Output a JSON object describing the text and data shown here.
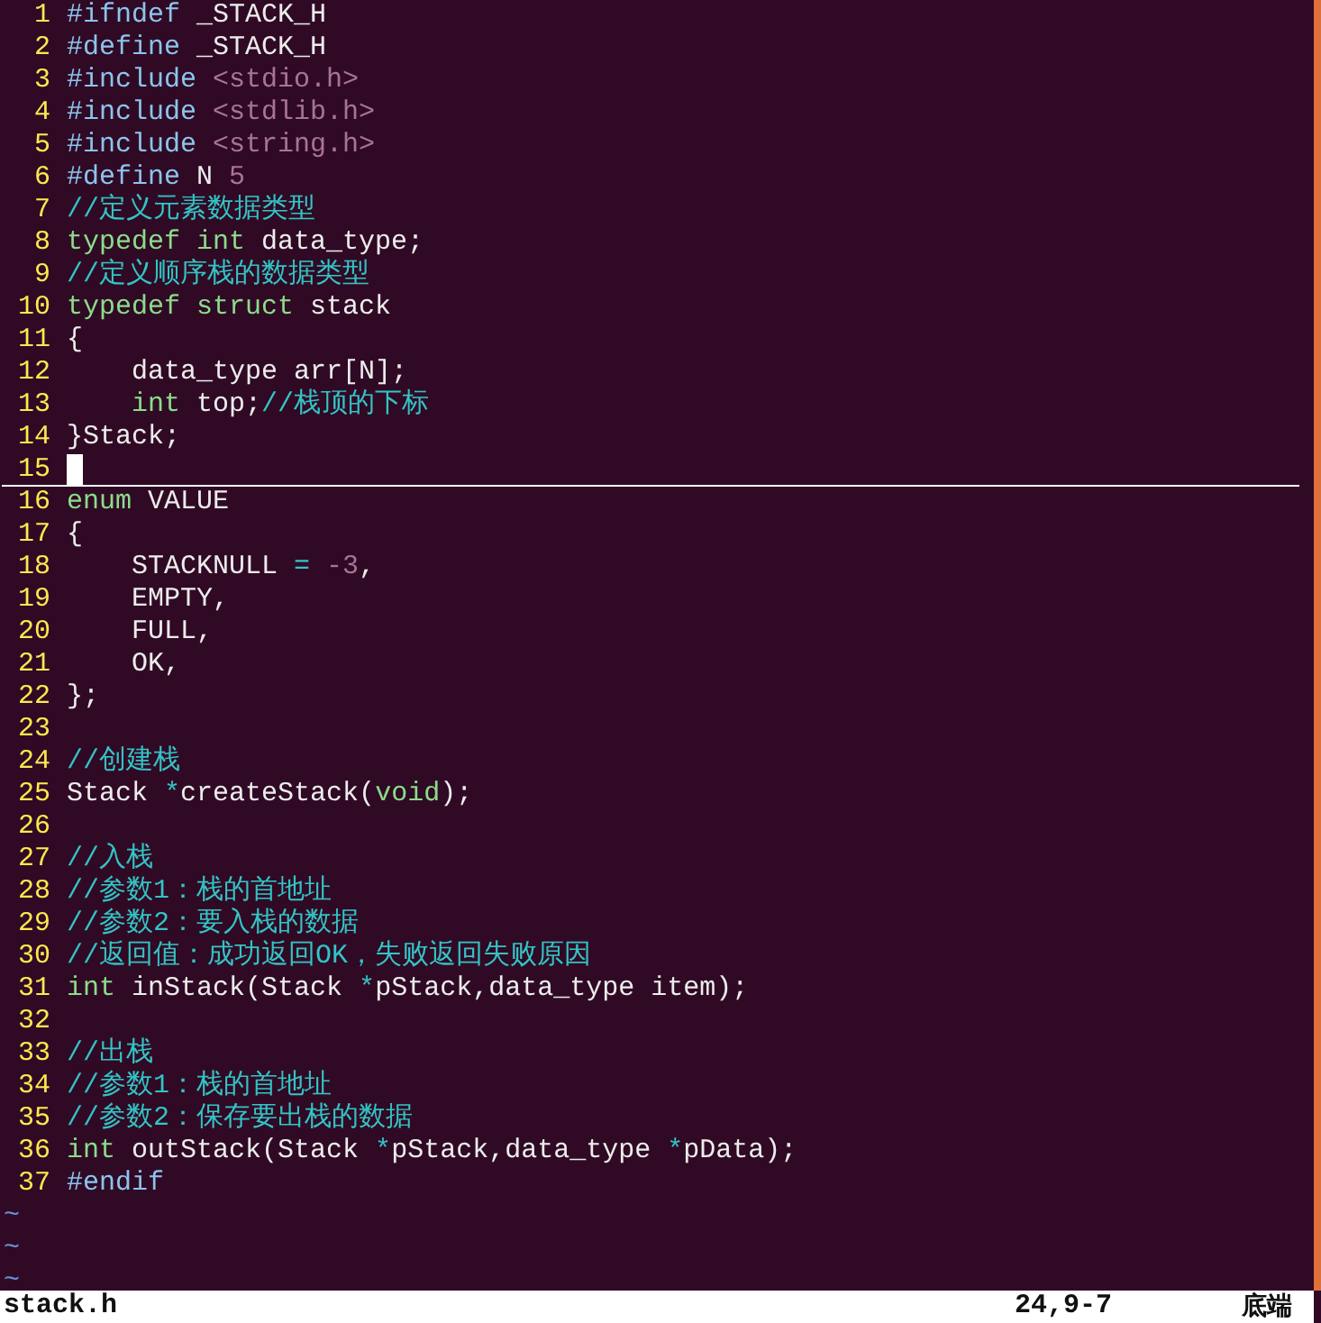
{
  "editor": {
    "lines": [
      {
        "number": "1",
        "current": false,
        "tokens": [
          {
            "text": "#ifndef",
            "kind": "preproc"
          },
          {
            "text": " _STACK_H",
            "kind": "plain"
          }
        ]
      },
      {
        "number": "2",
        "current": false,
        "tokens": [
          {
            "text": "#define",
            "kind": "preproc"
          },
          {
            "text": " _STACK_H",
            "kind": "plain"
          }
        ]
      },
      {
        "number": "3",
        "current": false,
        "tokens": [
          {
            "text": "#include",
            "kind": "preproc"
          },
          {
            "text": " <stdio.h>",
            "kind": "string"
          }
        ]
      },
      {
        "number": "4",
        "current": false,
        "tokens": [
          {
            "text": "#include",
            "kind": "preproc"
          },
          {
            "text": " <stdlib.h>",
            "kind": "string"
          }
        ]
      },
      {
        "number": "5",
        "current": false,
        "tokens": [
          {
            "text": "#include",
            "kind": "preproc"
          },
          {
            "text": " <string.h>",
            "kind": "string"
          }
        ]
      },
      {
        "number": "6",
        "current": false,
        "tokens": [
          {
            "text": "#define",
            "kind": "preproc"
          },
          {
            "text": " N ",
            "kind": "plain"
          },
          {
            "text": "5",
            "kind": "number"
          }
        ]
      },
      {
        "number": "7",
        "current": false,
        "tokens": [
          {
            "text": "//定义元素数据类型",
            "kind": "comment"
          }
        ]
      },
      {
        "number": "8",
        "current": false,
        "tokens": [
          {
            "text": "typedef int",
            "kind": "type"
          },
          {
            "text": " data_type;",
            "kind": "plain"
          }
        ]
      },
      {
        "number": "9",
        "current": false,
        "tokens": [
          {
            "text": "//定义顺序栈的数据类型",
            "kind": "comment"
          }
        ]
      },
      {
        "number": "10",
        "current": false,
        "tokens": [
          {
            "text": "typedef struct",
            "kind": "type"
          },
          {
            "text": " stack",
            "kind": "plain"
          }
        ]
      },
      {
        "number": "11",
        "current": false,
        "tokens": [
          {
            "text": "{",
            "kind": "plain"
          }
        ]
      },
      {
        "number": "12",
        "current": false,
        "tokens": [
          {
            "text": "    data_type arr[N];",
            "kind": "plain"
          }
        ]
      },
      {
        "number": "13",
        "current": false,
        "tokens": [
          {
            "text": "    int",
            "kind": "type"
          },
          {
            "text": " top;",
            "kind": "plain"
          },
          {
            "text": "//栈顶的下标",
            "kind": "comment"
          }
        ]
      },
      {
        "number": "14",
        "current": false,
        "tokens": [
          {
            "text": "}Stack;",
            "kind": "plain"
          }
        ]
      },
      {
        "number": "15",
        "current": true
      },
      {
        "number": "16",
        "current": false,
        "tokens": [
          {
            "text": "enum",
            "kind": "type"
          },
          {
            "text": " VALUE",
            "kind": "plain"
          }
        ]
      },
      {
        "number": "17",
        "current": false,
        "tokens": [
          {
            "text": "{",
            "kind": "plain"
          }
        ]
      },
      {
        "number": "18",
        "current": false,
        "tokens": [
          {
            "text": "    STACKNULL ",
            "kind": "plain"
          },
          {
            "text": "=",
            "kind": "operator"
          },
          {
            "text": " -3",
            "kind": "number"
          },
          {
            "text": ",",
            "kind": "plain"
          }
        ]
      },
      {
        "number": "19",
        "current": false,
        "tokens": [
          {
            "text": "    EMPTY,",
            "kind": "plain"
          }
        ]
      },
      {
        "number": "20",
        "current": false,
        "tokens": [
          {
            "text": "    FULL,",
            "kind": "plain"
          }
        ]
      },
      {
        "number": "21",
        "current": false,
        "tokens": [
          {
            "text": "    OK,",
            "kind": "plain"
          }
        ]
      },
      {
        "number": "22",
        "current": false,
        "tokens": [
          {
            "text": "};",
            "kind": "plain"
          }
        ]
      },
      {
        "number": "23",
        "current": false
      },
      {
        "number": "24",
        "current": false,
        "tokens": [
          {
            "text": "//创建栈",
            "kind": "comment"
          }
        ]
      },
      {
        "number": "25",
        "current": false,
        "tokens": [
          {
            "text": "Stack ",
            "kind": "plain"
          },
          {
            "text": "*",
            "kind": "operator"
          },
          {
            "text": "createStack(",
            "kind": "plain"
          },
          {
            "text": "void",
            "kind": "type"
          },
          {
            "text": ");",
            "kind": "plain"
          }
        ]
      },
      {
        "number": "26",
        "current": false
      },
      {
        "number": "27",
        "current": false,
        "tokens": [
          {
            "text": "//入栈",
            "kind": "comment"
          }
        ]
      },
      {
        "number": "28",
        "current": false,
        "tokens": [
          {
            "text": "//参数1：栈的首地址",
            "kind": "comment"
          }
        ]
      },
      {
        "number": "29",
        "current": false,
        "tokens": [
          {
            "text": "//参数2：要入栈的数据",
            "kind": "comment"
          }
        ]
      },
      {
        "number": "30",
        "current": false,
        "tokens": [
          {
            "text": "//返回值：成功返回OK，失败返回失败原因",
            "kind": "comment"
          }
        ]
      },
      {
        "number": "31",
        "current": false,
        "tokens": [
          {
            "text": "int",
            "kind": "type"
          },
          {
            "text": " inStack(Stack ",
            "kind": "plain"
          },
          {
            "text": "*",
            "kind": "operator"
          },
          {
            "text": "pStack,data_type item);",
            "kind": "plain"
          }
        ]
      },
      {
        "number": "32",
        "current": false
      },
      {
        "number": "33",
        "current": false,
        "tokens": [
          {
            "text": "//出栈",
            "kind": "comment"
          }
        ]
      },
      {
        "number": "34",
        "current": false,
        "tokens": [
          {
            "text": "//参数1：栈的首地址",
            "kind": "comment"
          }
        ]
      },
      {
        "number": "35",
        "current": false,
        "tokens": [
          {
            "text": "//参数2：保存要出栈的数据",
            "kind": "comment"
          }
        ]
      },
      {
        "number": "36",
        "current": false,
        "tokens": [
          {
            "text": "int",
            "kind": "type"
          },
          {
            "text": " outStack(Stack ",
            "kind": "plain"
          },
          {
            "text": "*",
            "kind": "operator"
          },
          {
            "text": "pStack,data_type ",
            "kind": "plain"
          },
          {
            "text": "*",
            "kind": "operator"
          },
          {
            "text": "pData);",
            "kind": "plain"
          }
        ]
      },
      {
        "number": "37",
        "current": false,
        "tokens": [
          {
            "text": "#endif",
            "kind": "preproc"
          }
        ]
      }
    ],
    "filler": [
      "~",
      "~",
      "~"
    ]
  },
  "status_bar": {
    "file": "stack.h",
    "position": "24,9-7",
    "scroll": "底端"
  }
}
